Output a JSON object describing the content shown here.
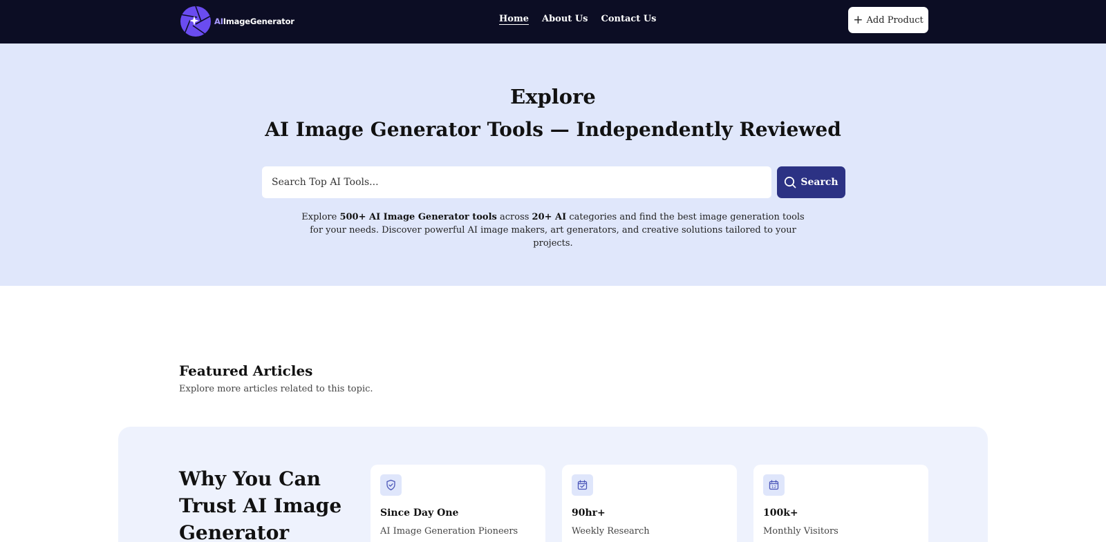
{
  "nav": {
    "logo_ai": "AI",
    "logo_rest": "ImageGenerator",
    "links": [
      {
        "label": "Home"
      },
      {
        "label": "About Us"
      },
      {
        "label": "Contact Us"
      }
    ],
    "add_product_label": "Add Product"
  },
  "hero": {
    "line1": "Explore",
    "line2": "AI Image Generator Tools — Independently Reviewed",
    "search_placeholder": "Search Top AI Tools...",
    "search_label": "Search",
    "desc_parts": {
      "p1": "Explore ",
      "b1": "500+ AI Image Generator tools",
      "p2": " across ",
      "b2": "20+ AI",
      "p3": " categories and find the best image generation tools for your needs. Discover powerful AI image makers, art generators, and creative solutions tailored to your projects."
    }
  },
  "featured": {
    "title": "Featured Articles",
    "subtitle": "Explore more articles related to this topic."
  },
  "trust": {
    "title": "Why You Can Trust AI Image Generator",
    "stats": [
      {
        "icon": "shield-check-icon",
        "value": "Since Day One",
        "label": "AI Image Generation Pioneers"
      },
      {
        "icon": "calendar-check-icon",
        "value": "90hr+",
        "label": "Weekly Research"
      },
      {
        "icon": "calendar-date-icon",
        "value": "100k+",
        "label": "Monthly Visitors",
        "icon_text": "12"
      }
    ]
  },
  "colors": {
    "nav_bg": "#0c0d24",
    "hero_bg": "#e0e7fb",
    "search_button": "#2c3284",
    "logo": "#6a4cf0",
    "trust_bg": "#eef2fd"
  }
}
